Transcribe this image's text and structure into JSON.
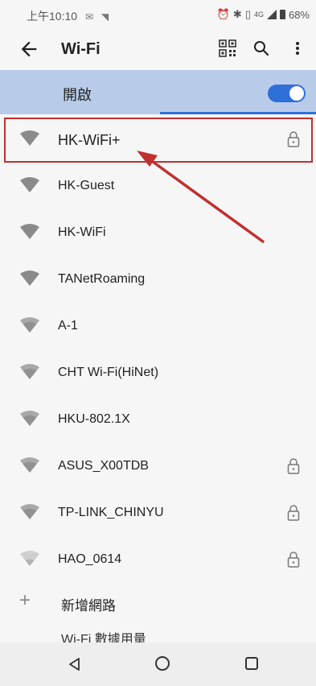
{
  "status_bar": {
    "time": "上午10:10",
    "right_text": "68%",
    "network": "4G"
  },
  "app_bar": {
    "title": "Wi-Fi",
    "back_icon": "arrow-left-icon",
    "qr_icon": "qr-code-icon",
    "search_icon": "search-icon",
    "more_icon": "more-vert-icon"
  },
  "toggle": {
    "label": "開啟",
    "on": true,
    "accent": "#2f6fd8"
  },
  "networks": [
    {
      "name": "HK-WiFi+",
      "locked": true,
      "strength": "full"
    },
    {
      "name": "HK-Guest",
      "locked": false,
      "strength": "full"
    },
    {
      "name": "HK-WiFi",
      "locked": false,
      "strength": "full"
    },
    {
      "name": "TANetRoaming",
      "locked": false,
      "strength": "full"
    },
    {
      "name": "A-1",
      "locked": false,
      "strength": "medium"
    },
    {
      "name": "CHT Wi-Fi(HiNet)",
      "locked": false,
      "strength": "medium"
    },
    {
      "name": "HKU-802.1X",
      "locked": false,
      "strength": "medium"
    },
    {
      "name": "ASUS_X00TDB",
      "locked": true,
      "strength": "medium"
    },
    {
      "name": "TP-LINK_CHINYU",
      "locked": true,
      "strength": "medium"
    },
    {
      "name": "HAO_0614",
      "locked": true,
      "strength": "weak"
    }
  ],
  "add_network": {
    "label": "新增網路"
  },
  "data_usage": {
    "label": "Wi-Fi 數據用量"
  },
  "annotation": {
    "color": "#c0302f"
  }
}
